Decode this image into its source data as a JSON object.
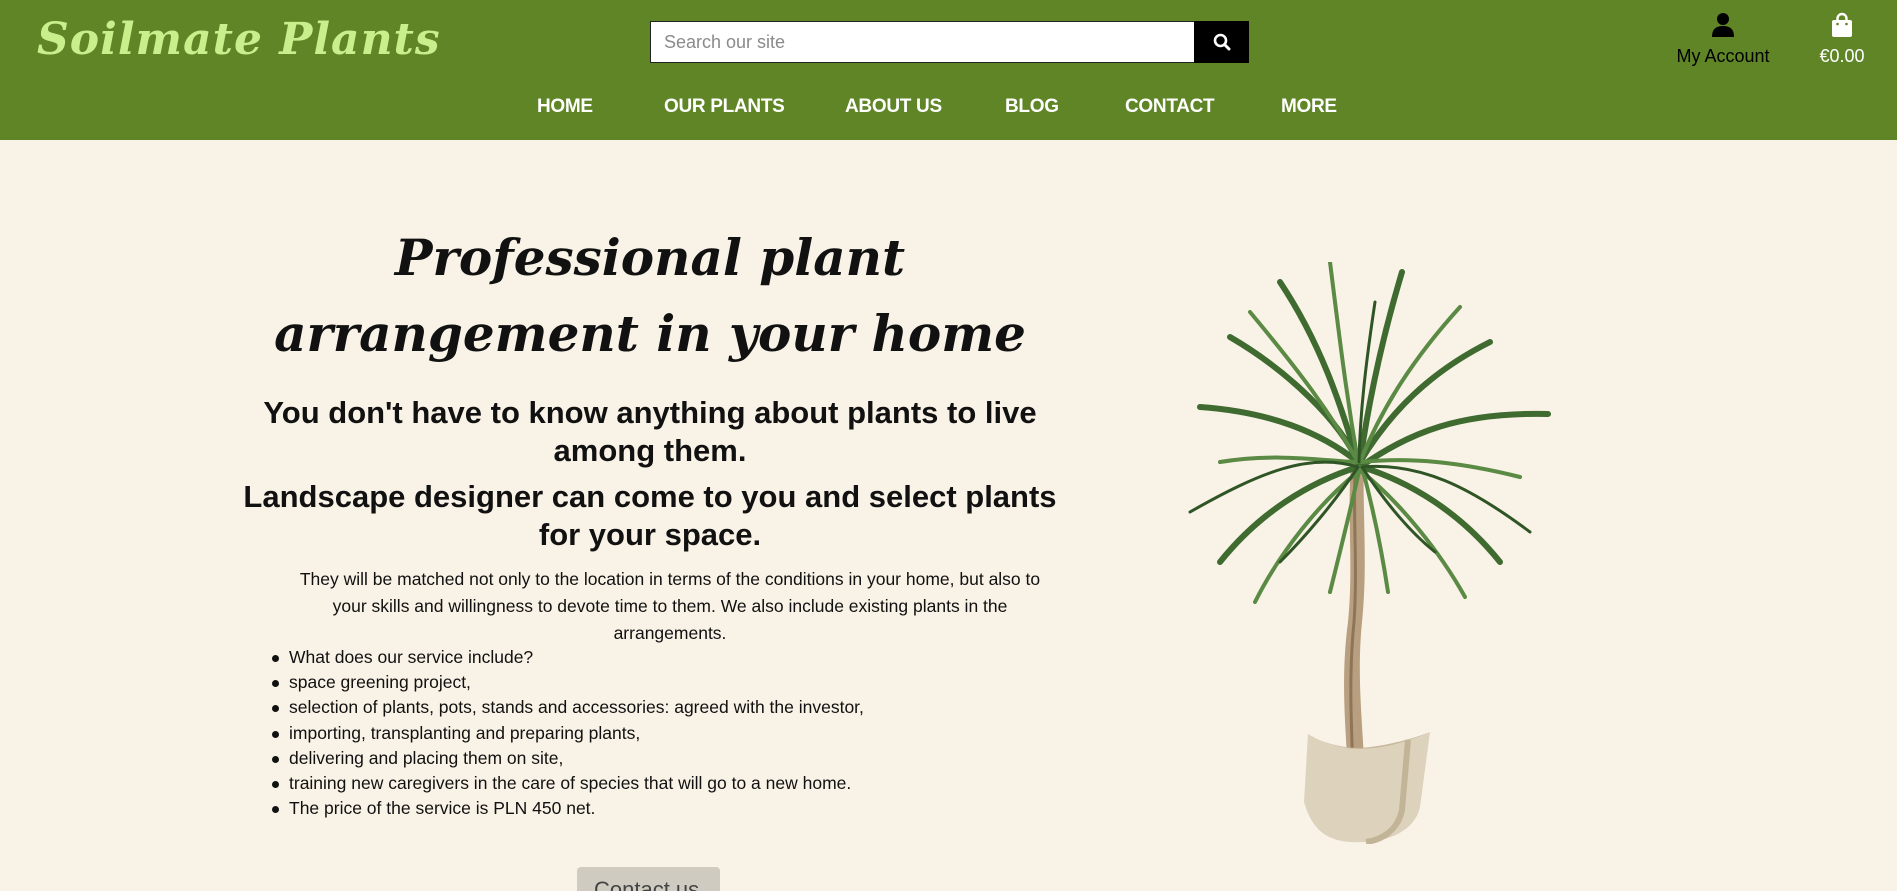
{
  "brand": {
    "logo": "Soilmate Plants"
  },
  "search": {
    "placeholder": "Search our site"
  },
  "account": {
    "label": "My Account"
  },
  "cart": {
    "total": "€0.00"
  },
  "nav": [
    {
      "label": "HOME"
    },
    {
      "label": "OUR PLANTS"
    },
    {
      "label": "ABOUT US"
    },
    {
      "label": "BLOG"
    },
    {
      "label": "CONTACT"
    },
    {
      "label": "MORE"
    }
  ],
  "hero": {
    "title": "Professional plant arrangement in your home",
    "lead1": "You don't have to know anything about plants to live among them.",
    "lead2": "Landscape designer can come to you and select plants for your space.",
    "paragraph": "They will be matched not only to the location in terms of the conditions in your home, but also to your skills and willingness to devote time to them. We also include existing plants in the arrangements.",
    "services": [
      "What does our service include?",
      "space greening project,",
      "selection of plants, pots, stands and accessories: agreed with the investor,",
      "importing, transplanting and preparing plants,",
      "delivering and placing them on site,",
      "training new caregivers in the care of species that will go to a new home.",
      "The price of the service is PLN 450 net."
    ],
    "cta": "Contact us"
  },
  "colors": {
    "header_bg": "#5f8526",
    "logo": "#c8ef8c",
    "page_bg": "#f9f2e6",
    "button_bg": "#cfcbc0"
  },
  "icons": {
    "search": "search-icon",
    "account": "user-icon",
    "cart": "shopping-bag-icon"
  }
}
